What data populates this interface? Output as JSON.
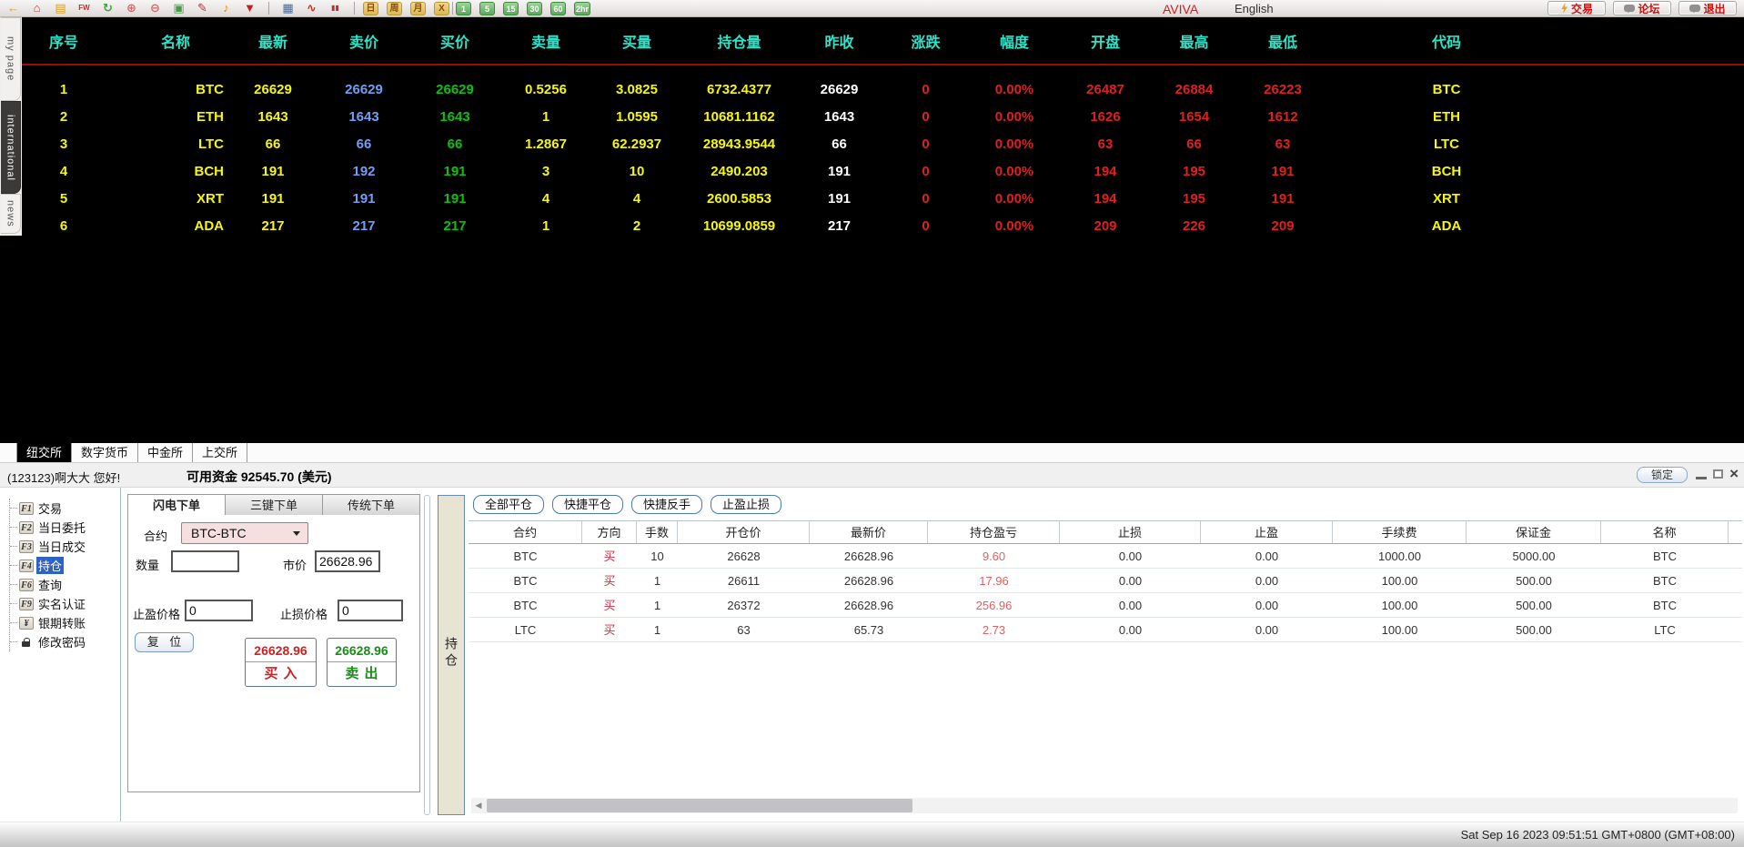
{
  "toolbar": {
    "icons": [
      {
        "name": "back-icon",
        "glyph": "←",
        "color": "#d89b28"
      },
      {
        "name": "home-icon",
        "glyph": "⌂",
        "color": "#b04030"
      },
      {
        "name": "ledger-icon",
        "glyph": "▤",
        "color": "#d8a020"
      },
      {
        "name": "fw-icon",
        "glyph": "FW",
        "color": "#c03028",
        "small": true
      },
      {
        "name": "refresh-icon",
        "glyph": "↻",
        "color": "#3aa83a"
      },
      {
        "name": "zoom-in-icon",
        "glyph": "⊕",
        "color": "#d06868"
      },
      {
        "name": "zoom-out-icon",
        "glyph": "⊖",
        "color": "#d06868"
      },
      {
        "name": "layers-icon",
        "glyph": "▣",
        "color": "#4a9a4a"
      },
      {
        "name": "edit-icon",
        "glyph": "✎",
        "color": "#c03028"
      },
      {
        "name": "horn-icon",
        "glyph": "♪",
        "color": "#e08818"
      },
      {
        "name": "filter-icon",
        "glyph": "▼",
        "color": "#c02020"
      },
      "|",
      {
        "name": "quote-table-icon",
        "glyph": "▦",
        "color": "#4a6a9a"
      },
      {
        "name": "line-chart-icon",
        "glyph": "∿",
        "color": "#c03028"
      },
      {
        "name": "candle-chart-icon",
        "glyph": "▮▮",
        "color": "#b83030",
        "small": true
      },
      "|"
    ],
    "period_buttons": [
      "日",
      "周",
      "月",
      "X"
    ],
    "interval_buttons": [
      "1",
      "5",
      "15",
      "30",
      "60",
      "2hr"
    ],
    "brand": "AVIVA",
    "language": "English",
    "actions": [
      {
        "name": "trade-button",
        "icon": "lightning",
        "label": "交易"
      },
      {
        "name": "forum-button",
        "icon": "chat",
        "label": "论坛"
      },
      {
        "name": "exit-button",
        "icon": "chat",
        "label": "退出"
      }
    ]
  },
  "side_tabs": {
    "items": [
      "my page",
      "international",
      "news"
    ],
    "active_index": 1
  },
  "market_table": {
    "columns": [
      "序号",
      "名称",
      "最新",
      "卖价",
      "买价",
      "卖量",
      "买量",
      "持仓量",
      "昨收",
      "涨跌",
      "幅度",
      "开盘",
      "最高",
      "最低",
      "代码"
    ],
    "rows": [
      [
        "1",
        "BTC",
        "26629",
        "26629",
        "26629",
        "0.5256",
        "3.0825",
        "6732.4377",
        "26629",
        "0",
        "0.00%",
        "26487",
        "26884",
        "26223",
        "BTC"
      ],
      [
        "2",
        "ETH",
        "1643",
        "1643",
        "1643",
        "1",
        "1.0595",
        "10681.1162",
        "1643",
        "0",
        "0.00%",
        "1626",
        "1654",
        "1612",
        "ETH"
      ],
      [
        "3",
        "LTC",
        "66",
        "66",
        "66",
        "1.2867",
        "62.2937",
        "28943.9544",
        "66",
        "0",
        "0.00%",
        "63",
        "66",
        "63",
        "LTC"
      ],
      [
        "4",
        "BCH",
        "191",
        "192",
        "191",
        "3",
        "10",
        "2490.203",
        "191",
        "0",
        "0.00%",
        "194",
        "195",
        "191",
        "BCH"
      ],
      [
        "5",
        "XRT",
        "191",
        "191",
        "191",
        "4",
        "4",
        "2600.5853",
        "191",
        "0",
        "0.00%",
        "194",
        "195",
        "191",
        "XRT"
      ],
      [
        "6",
        "ADA",
        "217",
        "217",
        "217",
        "1",
        "2",
        "10699.0859",
        "217",
        "0",
        "0.00%",
        "209",
        "226",
        "209",
        "ADA"
      ]
    ]
  },
  "exchange_tabs": {
    "items": [
      "纽交所",
      "数字货币",
      "中金所",
      "上交所"
    ],
    "active_index": 0
  },
  "account_bar": {
    "greeting": "(123123)啊大大 您好!",
    "funds": "可用资金 92545.70 (美元)",
    "lock_label": "锁定"
  },
  "sidebar_menu": {
    "items": [
      {
        "key": "F1",
        "label": "交易"
      },
      {
        "key": "F2",
        "label": "当日委托"
      },
      {
        "key": "F3",
        "label": "当日成交"
      },
      {
        "key": "F4",
        "label": "持仓"
      },
      {
        "key": "F6",
        "label": "查询"
      },
      {
        "key": "F9",
        "label": "实名认证"
      },
      {
        "key": "¥",
        "label": "银期转账"
      },
      {
        "key": "lock",
        "label": "修改密码",
        "icon": "lock"
      }
    ],
    "active_index": 3
  },
  "order_panel": {
    "tabs": [
      "闪电下单",
      "三键下单",
      "传统下单"
    ],
    "active_tab": 0,
    "contract_label": "合约",
    "contract_value": "BTC-BTC",
    "qty_label": "数量",
    "qty_value": "",
    "market_label": "市价",
    "market_value": "26628.96",
    "tp_label": "止盈价格",
    "tp_value": "0",
    "sl_label": "止损价格",
    "sl_value": "0",
    "reset_label": "复 位",
    "buy": {
      "price": "26628.96",
      "label": "买入"
    },
    "sell": {
      "price": "26628.96",
      "label": "卖出"
    }
  },
  "position_panel": {
    "vertical_tab": "持仓",
    "buttons": [
      "全部平仓",
      "快捷平仓",
      "快捷反手",
      "止盈止损"
    ],
    "columns": [
      "合约",
      "方向",
      "手数",
      "开仓价",
      "最新价",
      "持仓盈亏",
      "止损",
      "止盈",
      "手续费",
      "保证金",
      "名称"
    ],
    "rows": [
      [
        "BTC",
        "买",
        "10",
        "26628",
        "26628.96",
        "9.60",
        "0.00",
        "0.00",
        "1000.00",
        "5000.00",
        "BTC"
      ],
      [
        "BTC",
        "买",
        "1",
        "26611",
        "26628.96",
        "17.96",
        "0.00",
        "0.00",
        "100.00",
        "500.00",
        "BTC"
      ],
      [
        "BTC",
        "买",
        "1",
        "26372",
        "26628.96",
        "256.96",
        "0.00",
        "0.00",
        "100.00",
        "500.00",
        "BTC"
      ],
      [
        "LTC",
        "买",
        "1",
        "63",
        "65.73",
        "2.73",
        "0.00",
        "0.00",
        "100.00",
        "500.00",
        "LTC"
      ]
    ]
  },
  "status_bar": {
    "timestamp": "Sat Sep 16 2023 09:51:51 GMT+0800 (GMT+08:00)"
  },
  "colors": {
    "header_cyan": "#2fe3c8",
    "yellow": "#f8f800",
    "ask_blue": "#6f9ff5",
    "bid_green": "#0ac20a",
    "down_red": "#e01f1f",
    "buy_red": "#cc2222",
    "sell_green": "#1a8a1a",
    "highlight_blue": "#2f62c5"
  }
}
